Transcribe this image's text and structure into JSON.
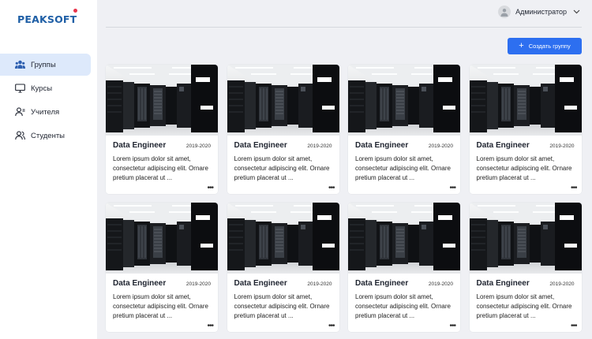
{
  "app": {
    "logo": "PEAKSOFT"
  },
  "sidebar": {
    "items": [
      {
        "label": "Группы",
        "icon": "groups-icon",
        "active": true
      },
      {
        "label": "Курсы",
        "icon": "monitor-icon",
        "active": false
      },
      {
        "label": "Учителя",
        "icon": "teacher-icon",
        "active": false
      },
      {
        "label": "Студенты",
        "icon": "students-icon",
        "active": false
      }
    ]
  },
  "header": {
    "user_name": "Администратор"
  },
  "toolbar": {
    "create_label": "Создать группу"
  },
  "cards": [
    {
      "title": "Data Engineer",
      "year": "2019-2020",
      "desc": "Lorem ipsum dolor sit amet, consectetur adipiscing elit. Ornare pretium placerat ut ...",
      "more": "•••"
    },
    {
      "title": "Data Engineer",
      "year": "2019-2020",
      "desc": "Lorem ipsum dolor sit amet, consectetur adipiscing elit. Ornare pretium placerat ut ...",
      "more": "•••"
    },
    {
      "title": "Data Engineer",
      "year": "2019-2020",
      "desc": "Lorem ipsum dolor sit amet, consectetur adipiscing elit. Ornare pretium placerat ut ...",
      "more": "•••"
    },
    {
      "title": "Data Engineer",
      "year": "2019-2020",
      "desc": "Lorem ipsum dolor sit amet, consectetur adipiscing elit. Ornare pretium placerat ut ...",
      "more": "•••"
    },
    {
      "title": "Data Engineer",
      "year": "2019-2020",
      "desc": "Lorem ipsum dolor sit amet, consectetur adipiscing elit. Ornare pretium placerat ut ...",
      "more": "•••"
    },
    {
      "title": "Data Engineer",
      "year": "2019-2020",
      "desc": "Lorem ipsum dolor sit amet, consectetur adipiscing elit. Ornare pretium placerat ut ...",
      "more": "•••"
    },
    {
      "title": "Data Engineer",
      "year": "2019-2020",
      "desc": "Lorem ipsum dolor sit amet, consectetur adipiscing elit. Ornare pretium placerat ut ...",
      "more": "•••"
    },
    {
      "title": "Data Engineer",
      "year": "2019-2020",
      "desc": "Lorem ipsum dolor sit amet, consectetur adipiscing elit. Ornare pretium placerat ut ...",
      "more": "•••"
    }
  ],
  "colors": {
    "accent": "#2d6ff0",
    "brand": "#1f5fa6",
    "active_bg": "#dde9fb",
    "main_bg": "#eff0f4",
    "logo_dot": "#e8344b"
  }
}
